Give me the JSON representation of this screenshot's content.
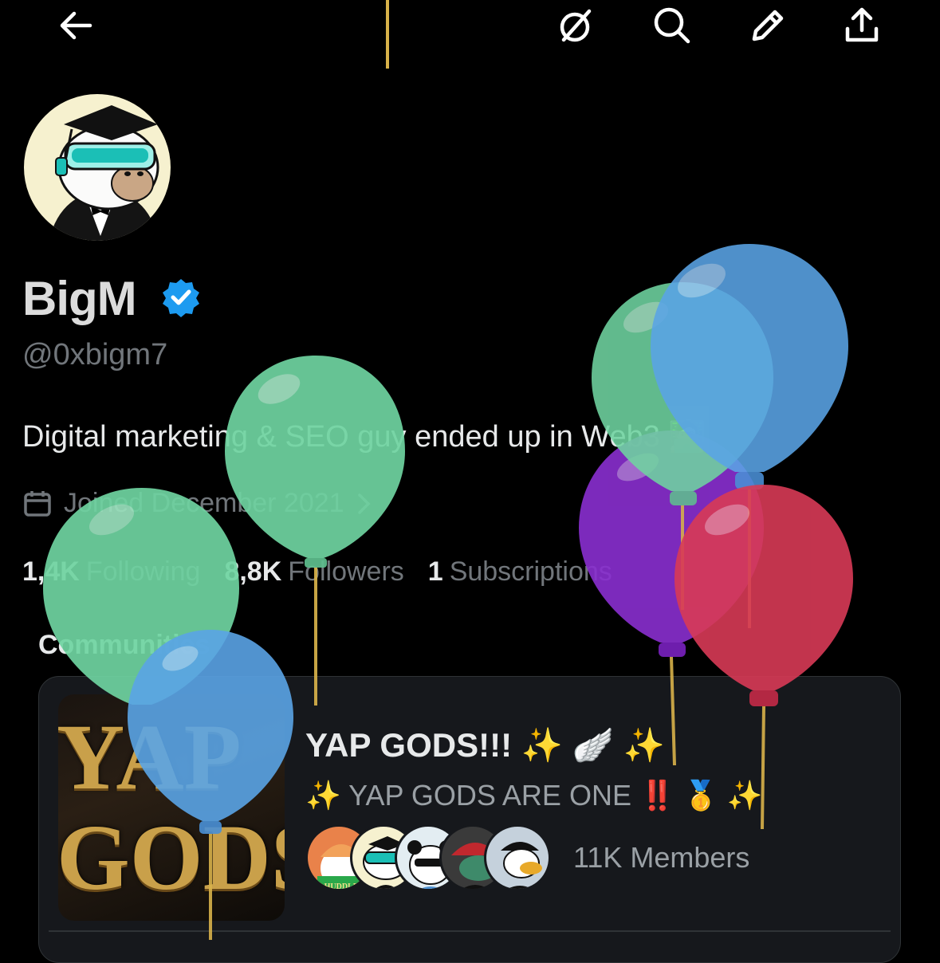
{
  "header": {
    "back_icon": "arrow-left-icon",
    "actions": [
      "grok-icon",
      "search-icon",
      "edit-icon",
      "share-icon"
    ]
  },
  "profile": {
    "display_name": "BigM",
    "verified": true,
    "handle": "@0xbigm7",
    "bio": "Digital marketing & SEO guy ended up in Web3 🧑🏻‍💻",
    "joined": "Joined December 2021",
    "following_count": "1,4K",
    "following_label": "Following",
    "followers_count": "8,8K",
    "followers_label": "Followers",
    "subscriptions_count": "1",
    "subscriptions_label": "Subscriptions"
  },
  "communities": {
    "title": "Communities",
    "items": [
      {
        "cover_text_top": "YAP",
        "cover_text_bottom": "GODS",
        "name": "YAP GODS!!! ✨ 🪽 ✨",
        "description": "✨ YAP GODS ARE ONE ‼️ 🥇 ✨",
        "member_avatar_label": "HUDDLE",
        "members": "11K Members"
      }
    ]
  },
  "colors": {
    "background": "#000000",
    "verified": "#1d9bf0",
    "balloon_green": "#6fd4a1",
    "balloon_blue": "#5aa4e6",
    "balloon_purple": "#8a2fd0",
    "balloon_red": "#d83a56"
  }
}
